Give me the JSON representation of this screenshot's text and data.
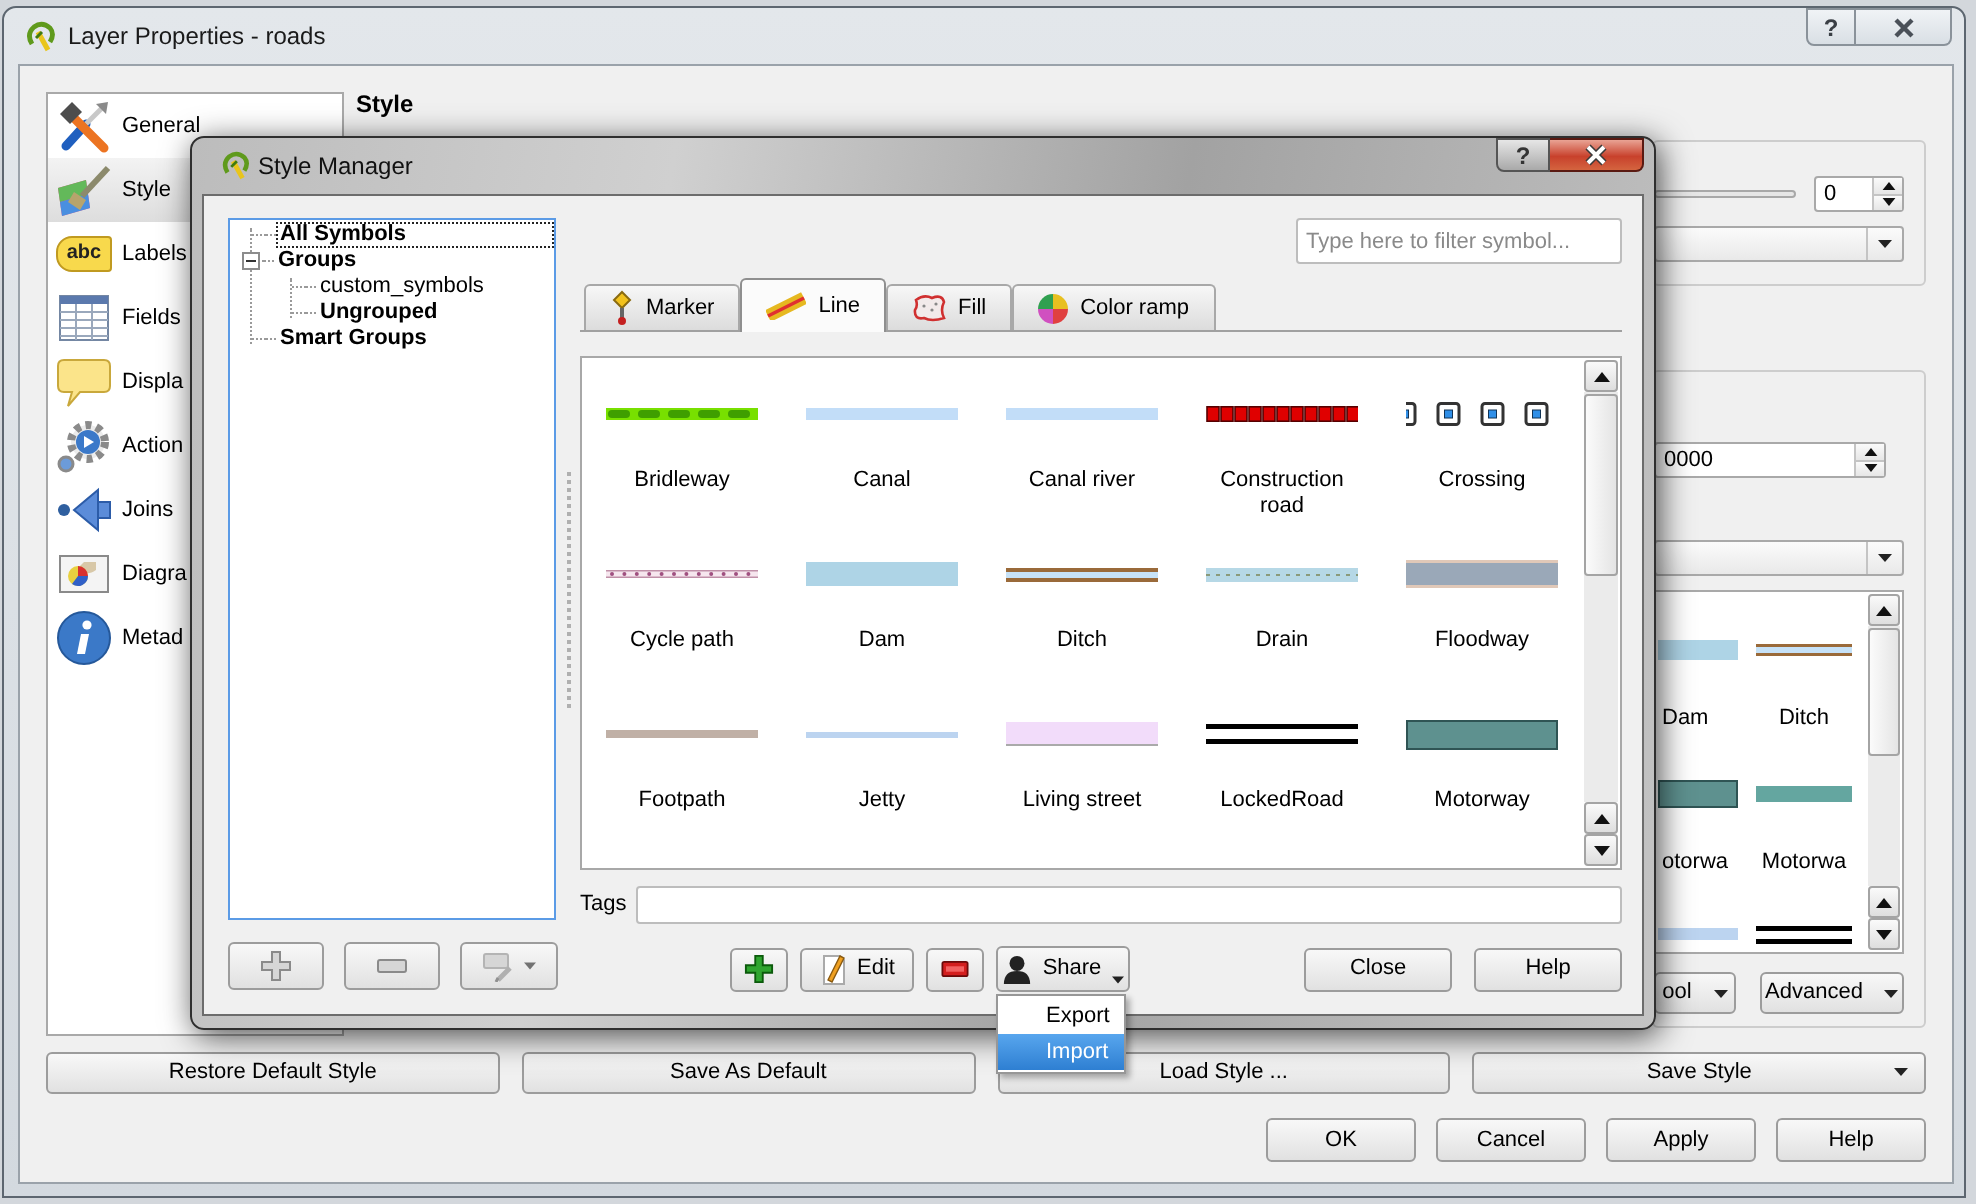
{
  "layer_properties": {
    "title": "Layer Properties - roads",
    "help_button": "?",
    "sidebar": [
      {
        "label": "General",
        "selected": false
      },
      {
        "label": "Style",
        "selected": true
      },
      {
        "label": "Labels",
        "selected": false,
        "icon_text": "abc"
      },
      {
        "label": "Fields",
        "selected": false
      },
      {
        "label": "Displa",
        "selected": false
      },
      {
        "label": "Action",
        "selected": false
      },
      {
        "label": "Joins",
        "selected": false
      },
      {
        "label": "Diagra",
        "selected": false
      },
      {
        "label": "Metad",
        "selected": false
      }
    ],
    "section_title": "Style",
    "slider_value": "0",
    "spin_value": "0000",
    "symbol_list": [
      {
        "label": "Dam"
      },
      {
        "label": "Ditch"
      },
      {
        "label": "otorwa"
      },
      {
        "label": "Motorwa"
      }
    ],
    "panel_buttons": [
      "ool",
      "Advanced"
    ],
    "action_buttons": [
      {
        "label": "Restore Default Style",
        "menu": false
      },
      {
        "label": "Save As Default",
        "menu": false
      },
      {
        "label": "Load Style ...",
        "menu": false
      },
      {
        "label": "Save Style",
        "menu": true
      }
    ],
    "dialog_buttons": [
      "OK",
      "Cancel",
      "Apply",
      "Help"
    ]
  },
  "style_manager": {
    "title": "Style Manager",
    "help_button": "?",
    "group_tree": [
      {
        "label": "All Symbols",
        "kind": "category",
        "selected": true
      },
      {
        "label": "Groups",
        "kind": "category",
        "selected": false,
        "expanded": true,
        "children": [
          {
            "label": "custom_symbols",
            "kind": "group",
            "selected": false
          },
          {
            "label": "Ungrouped",
            "kind": "category",
            "selected": false
          }
        ]
      },
      {
        "label": "Smart Groups",
        "kind": "category",
        "selected": false
      }
    ],
    "group_buttons": [
      {
        "kind": "add",
        "disabled": true
      },
      {
        "kind": "remove",
        "disabled": true
      },
      {
        "kind": "rename",
        "disabled": true
      }
    ],
    "filter": {
      "placeholder": "Type here to filter symbol..."
    },
    "tabs": [
      {
        "label": "Marker",
        "selected": false
      },
      {
        "label": "Line",
        "selected": true
      },
      {
        "label": "Fill",
        "selected": false
      },
      {
        "label": "Color ramp",
        "selected": false
      }
    ],
    "symbols": [
      {
        "label": "Bridleway"
      },
      {
        "label": "Canal"
      },
      {
        "label": "Canal river"
      },
      {
        "label": "Construction road"
      },
      {
        "label": "Crossing"
      },
      {
        "label": "Cycle path"
      },
      {
        "label": "Dam"
      },
      {
        "label": "Ditch"
      },
      {
        "label": "Drain"
      },
      {
        "label": "Floodway"
      },
      {
        "label": "Footpath"
      },
      {
        "label": "Jetty"
      },
      {
        "label": "Living street"
      },
      {
        "label": "LockedRoad"
      },
      {
        "label": "Motorway"
      }
    ],
    "tags_label": "Tags",
    "buttons": {
      "edit": "Edit",
      "share": "Share",
      "close": "Close",
      "help": "Help"
    },
    "share_menu": [
      {
        "label": "Export",
        "selected": false
      },
      {
        "label": "Import",
        "selected": true
      }
    ]
  }
}
